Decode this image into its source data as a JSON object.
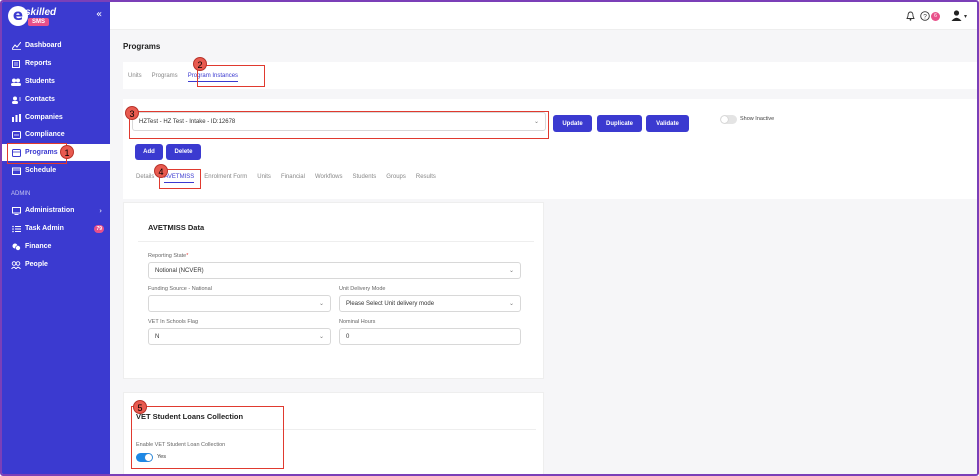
{
  "app": {
    "logo_letter": "e",
    "logo_word": "skilled",
    "logo_sub": "SMS",
    "collapse_glyph": "«"
  },
  "sidebar": {
    "items": [
      {
        "label": "Dashboard",
        "icon": "dashboard-icon"
      },
      {
        "label": "Reports",
        "icon": "reports-icon"
      },
      {
        "label": "Students",
        "icon": "students-icon"
      },
      {
        "label": "Contacts",
        "icon": "contacts-icon"
      },
      {
        "label": "Companies",
        "icon": "companies-icon"
      },
      {
        "label": "Compliance",
        "icon": "compliance-icon"
      },
      {
        "label": "Programs",
        "icon": "programs-icon"
      },
      {
        "label": "Schedule",
        "icon": "schedule-icon"
      }
    ],
    "section_label": "ADMIN",
    "admin_items": [
      {
        "label": "Administration",
        "icon": "administration-icon"
      },
      {
        "label": "Task Admin",
        "icon": "task-admin-icon",
        "badge": "79"
      },
      {
        "label": "Finance",
        "icon": "finance-icon"
      },
      {
        "label": "People",
        "icon": "people-icon"
      }
    ],
    "chevron": "›"
  },
  "topbar": {
    "notif_count": "6",
    "user_caret": "▾"
  },
  "page": {
    "title": "Programs",
    "tabs": [
      "Units",
      "Programs",
      "Program Instances"
    ],
    "instance_select": "HZTest - HZ Test - Intake - ID:12678",
    "buttons": {
      "update": "Update",
      "duplicate": "Duplicate",
      "validate": "Validate",
      "add": "Add",
      "delete": "Delete"
    },
    "show_inactive": "Show Inactive",
    "subtabs": [
      "Details",
      "AVETMISS",
      "Enrolment Form",
      "Units",
      "Financial",
      "Workflows",
      "Students",
      "Groups",
      "Results"
    ]
  },
  "avetmiss": {
    "title": "AVETMISS Data",
    "reporting_state_label": "Reporting State",
    "reporting_state_required": "*",
    "reporting_state_value": "Notional (NCVER)",
    "funding_label": "Funding Source - National",
    "funding_value": "",
    "delivery_label": "Unit Delivery Mode",
    "delivery_value": "Please Select Unit delivery mode",
    "vet_label": "VET In Schools Flag",
    "vet_value": "N",
    "hours_label": "Nominal Hours",
    "hours_value": "0"
  },
  "vsl": {
    "title": "VET Student Loans Collection",
    "enable_label": "Enable VET Student Loan Collection",
    "toggle_text": "Yes"
  },
  "annotations": [
    "1",
    "2",
    "3",
    "4",
    "5"
  ],
  "colors": {
    "primary": "#3b3ad0",
    "accent": "#e8508a",
    "annotation": "#e03a2f"
  }
}
